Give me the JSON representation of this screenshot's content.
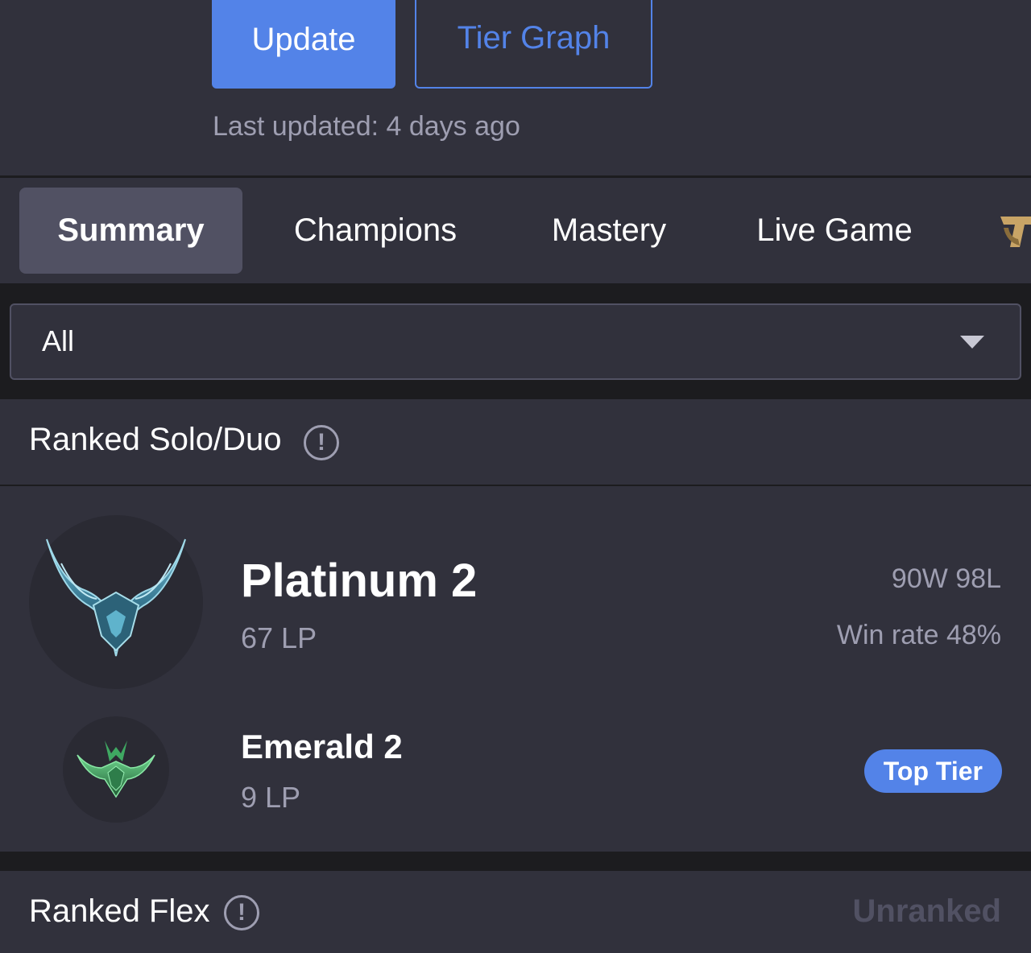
{
  "header": {
    "update_label": "Update",
    "tier_graph_label": "Tier Graph",
    "last_updated": "Last updated: 4 days ago"
  },
  "tabs": [
    {
      "label": "Summary",
      "active": true
    },
    {
      "label": "Champions",
      "active": false
    },
    {
      "label": "Mastery",
      "active": false
    },
    {
      "label": "Live Game",
      "active": false
    }
  ],
  "filter": {
    "selected": "All"
  },
  "ranked_solo": {
    "title": "Ranked Solo/Duo",
    "current": {
      "tier": "Platinum 2",
      "lp": "67 LP",
      "record": "90W 98L",
      "win_rate": "Win rate 48%"
    },
    "peak": {
      "tier": "Emerald 2",
      "lp": "9 LP",
      "badge": "Top Tier"
    }
  },
  "ranked_flex": {
    "title": "Ranked Flex",
    "status": "Unranked"
  },
  "colors": {
    "accent": "#5383e8",
    "background": "#31313c",
    "divider": "#1c1c1f",
    "muted_text": "#9e9eb1"
  }
}
